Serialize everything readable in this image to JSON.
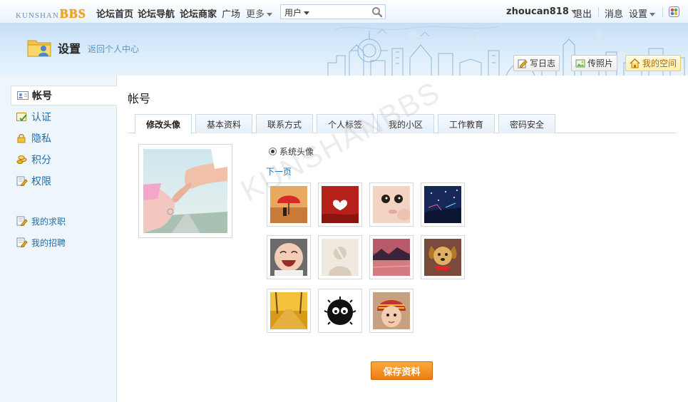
{
  "brand": {
    "logo_prefix": "KUNSHAN",
    "logo_suffix": "BBS"
  },
  "topnav": {
    "links": [
      "论坛首页",
      "论坛导航",
      "论坛商家",
      "广场",
      "更多"
    ],
    "search": {
      "type_label": "用户",
      "value": ""
    },
    "user": "zhoucan818",
    "logout": "退出",
    "messages": "消息",
    "settings": "设置"
  },
  "header": {
    "title": "设置",
    "back_link": "返回个人中心",
    "buttons": [
      "写日志",
      "传照片",
      "我的空间"
    ]
  },
  "sidebar": {
    "items": [
      "帐号",
      "认证",
      "隐私",
      "积分",
      "权限"
    ],
    "extra_items": [
      "我的求职",
      "我的招聘"
    ]
  },
  "main": {
    "title": "帐号",
    "tabs": [
      "修改头像",
      "基本资料",
      "联系方式",
      "个人标签",
      "我的小区",
      "工作教育",
      "密码安全"
    ],
    "active_tab": "修改头像",
    "radio_label": "系统头像",
    "next_page": "下一页",
    "avatars": [
      "red-umbrella-avatar",
      "red-heart-avatar",
      "baby-face-avatar",
      "night-sky-avatar",
      "laughing-baby-avatar",
      "placeholder-avatar",
      "sunset-lake-avatar",
      "puppy-avatar",
      "autumn-road-avatar",
      "soot-sprite-avatar",
      "knit-hat-girl-avatar"
    ],
    "watermark": "KUNSHANBBS",
    "save_button": "保存资料"
  },
  "colors": {
    "accent": "#f08a1c",
    "link": "#1d6fae",
    "sidebar_bg": "#eef5fb",
    "header_bg": "#c6e0f6"
  }
}
